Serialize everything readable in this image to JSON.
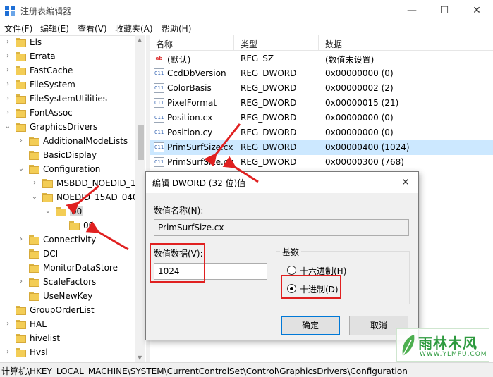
{
  "window": {
    "title": "注册表编辑器",
    "minimize_glyph": "—",
    "maximize_glyph": "☐",
    "close_glyph": "✕"
  },
  "menu": [
    "文件(F)",
    "编辑(E)",
    "查看(V)",
    "收藏夹(A)",
    "帮助(H)"
  ],
  "tree": {
    "items": [
      {
        "label": "Els",
        "arrow": "›",
        "indent": 0
      },
      {
        "label": "Errata",
        "arrow": "›",
        "indent": 0
      },
      {
        "label": "FastCache",
        "arrow": "›",
        "indent": 0
      },
      {
        "label": "FileSystem",
        "arrow": "›",
        "indent": 0
      },
      {
        "label": "FileSystemUtilities",
        "arrow": "›",
        "indent": 0
      },
      {
        "label": "FontAssoc",
        "arrow": "›",
        "indent": 0
      },
      {
        "label": "GraphicsDrivers",
        "arrow": "⌄",
        "indent": 0
      },
      {
        "label": "AdditionalModeLists",
        "arrow": "›",
        "indent": 1
      },
      {
        "label": "BasicDisplay",
        "arrow": "",
        "indent": 1
      },
      {
        "label": "Configuration",
        "arrow": "⌄",
        "indent": 1
      },
      {
        "label": "MSBDD_NOEDID_1",
        "arrow": "›",
        "indent": 2
      },
      {
        "label": "NOEDID_15AD_040",
        "arrow": "⌄",
        "indent": 2
      },
      {
        "label": "00",
        "arrow": "⌄",
        "indent": 3,
        "selected": true
      },
      {
        "label": "00",
        "arrow": "",
        "indent": 4
      },
      {
        "label": "Connectivity",
        "arrow": "›",
        "indent": 1
      },
      {
        "label": "DCI",
        "arrow": "",
        "indent": 1
      },
      {
        "label": "MonitorDataStore",
        "arrow": "",
        "indent": 1
      },
      {
        "label": "ScaleFactors",
        "arrow": "›",
        "indent": 1
      },
      {
        "label": "UseNewKey",
        "arrow": "",
        "indent": 1
      },
      {
        "label": "GroupOrderList",
        "arrow": "",
        "indent": 0
      },
      {
        "label": "HAL",
        "arrow": "›",
        "indent": 0
      },
      {
        "label": "hivelist",
        "arrow": "",
        "indent": 0
      },
      {
        "label": "Hvsi",
        "arrow": "›",
        "indent": 0
      }
    ]
  },
  "list": {
    "headers": {
      "name": "名称",
      "type": "类型",
      "data": "数据"
    },
    "rows": [
      {
        "icon": "ab",
        "name": "(默认)",
        "type": "REG_SZ",
        "data": "(数值未设置)"
      },
      {
        "icon": "bin",
        "name": "CcdDbVersion",
        "type": "REG_DWORD",
        "data": "0x00000000 (0)"
      },
      {
        "icon": "bin",
        "name": "ColorBasis",
        "type": "REG_DWORD",
        "data": "0x00000002 (2)"
      },
      {
        "icon": "bin",
        "name": "PixelFormat",
        "type": "REG_DWORD",
        "data": "0x00000015 (21)"
      },
      {
        "icon": "bin",
        "name": "Position.cx",
        "type": "REG_DWORD",
        "data": "0x00000000 (0)"
      },
      {
        "icon": "bin",
        "name": "Position.cy",
        "type": "REG_DWORD",
        "data": "0x00000000 (0)"
      },
      {
        "icon": "bin",
        "name": "PrimSurfSize.cx",
        "type": "REG_DWORD",
        "data": "0x00000400 (1024)",
        "selected": true
      },
      {
        "icon": "bin",
        "name": "PrimSurfSize.cy",
        "type": "REG_DWORD",
        "data": "0x00000300 (768)"
      }
    ]
  },
  "status": {
    "path": "计算机\\HKEY_LOCAL_MACHINE\\SYSTEM\\CurrentControlSet\\Control\\GraphicsDrivers\\Configuration"
  },
  "dialog": {
    "title": "编辑 DWORD (32 位)值",
    "close_glyph": "✕",
    "name_label": "数值名称(N):",
    "name_value": "PrimSurfSize.cx",
    "data_label": "数值数据(V):",
    "data_value": "1024",
    "base_label": "基数",
    "hex_label": "十六进制(H)",
    "dec_label": "十进制(D)",
    "selected_base": "decimal",
    "ok_label": "确定",
    "cancel_label": "取消"
  },
  "watermark": {
    "text": "雨林木风",
    "url": "WWW.YLMFU.COM"
  },
  "colors": {
    "accent": "#0078d7",
    "selection": "#cce8ff",
    "annotation_red": "#e02020",
    "folder": "#f3cd56"
  }
}
